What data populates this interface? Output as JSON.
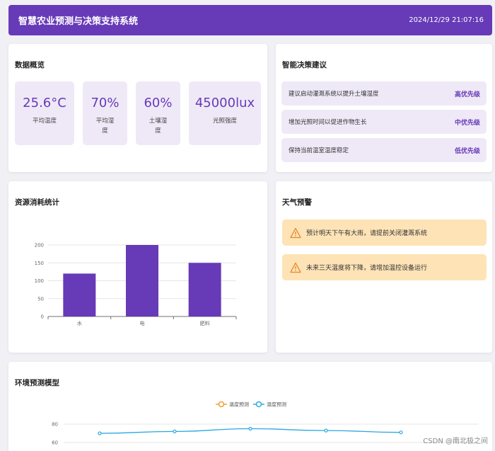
{
  "header": {
    "title": "智慧农业预测与决策支持系统",
    "time": "2024/12/29 21:07:16"
  },
  "overview": {
    "title": "数据概览",
    "stats": [
      {
        "value": "25.6°C",
        "label": "平均温度"
      },
      {
        "value": "70%",
        "label": "平均湿度"
      },
      {
        "value": "60%",
        "label": "土壤湿度"
      },
      {
        "value": "45000lux",
        "label": "光照强度"
      }
    ]
  },
  "advice": {
    "title": "智能决策建议",
    "items": [
      {
        "text": "建议启动灌溉系统以提升土壤湿度",
        "priority": "高优先级"
      },
      {
        "text": "增加光照时间以促进作物生长",
        "priority": "中优先级"
      },
      {
        "text": "保持当前温室温度稳定",
        "priority": "低优先级"
      }
    ]
  },
  "resource": {
    "title": "资源消耗统计"
  },
  "weather": {
    "title": "天气预警",
    "alerts": [
      {
        "text": "预计明天下午有大雨，请提前关闭灌溉系统"
      },
      {
        "text": "未来三天温度将下降，请增加温控设备运行"
      }
    ]
  },
  "env": {
    "title": "环境预测模型",
    "legend": [
      "温度预测",
      "湿度预测"
    ]
  },
  "watermark": "CSDN @南北极之间",
  "colors": {
    "accent": "#673ab7",
    "warn_bg": "#fde3b6",
    "temp_line": "#f0a030",
    "humidity_line": "#2aa8e0"
  },
  "chart_data": [
    {
      "type": "bar",
      "categories": [
        "水",
        "电",
        "肥料"
      ],
      "values": [
        120,
        200,
        150
      ],
      "ylim": [
        0,
        200
      ],
      "yticks": [
        0,
        50,
        100,
        150,
        200
      ]
    },
    {
      "type": "line",
      "series": [
        {
          "name": "温度预测",
          "values": []
        },
        {
          "name": "湿度预测",
          "values": [
            70,
            72,
            75,
            73,
            71
          ]
        }
      ],
      "yticks_visible": [
        60,
        80
      ]
    }
  ]
}
